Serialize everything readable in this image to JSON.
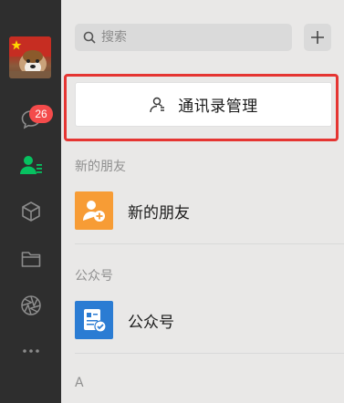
{
  "rail": {
    "items": [
      {
        "icon": "chat-icon",
        "badge": "26"
      },
      {
        "icon": "contacts-icon",
        "active": true
      },
      {
        "icon": "favorites-cube-icon"
      },
      {
        "icon": "folder-icon"
      },
      {
        "icon": "moments-aperture-icon"
      },
      {
        "icon": "more-dots-icon"
      }
    ]
  },
  "search": {
    "placeholder": "搜索"
  },
  "manage_button": {
    "label": "通讯录管理"
  },
  "sections": [
    {
      "header": "新的朋友",
      "item_label": "新的朋友",
      "icon": "new-friend-icon",
      "color": "#f79c35"
    },
    {
      "header": "公众号",
      "item_label": "公众号",
      "icon": "official-account-icon",
      "color": "#2b7cd3"
    },
    {
      "header": "A"
    }
  ],
  "colors": {
    "rail_bg": "#2e2e2e",
    "active_green": "#07c160",
    "badge_red": "#f44b4b",
    "highlight_red": "#e53532"
  }
}
